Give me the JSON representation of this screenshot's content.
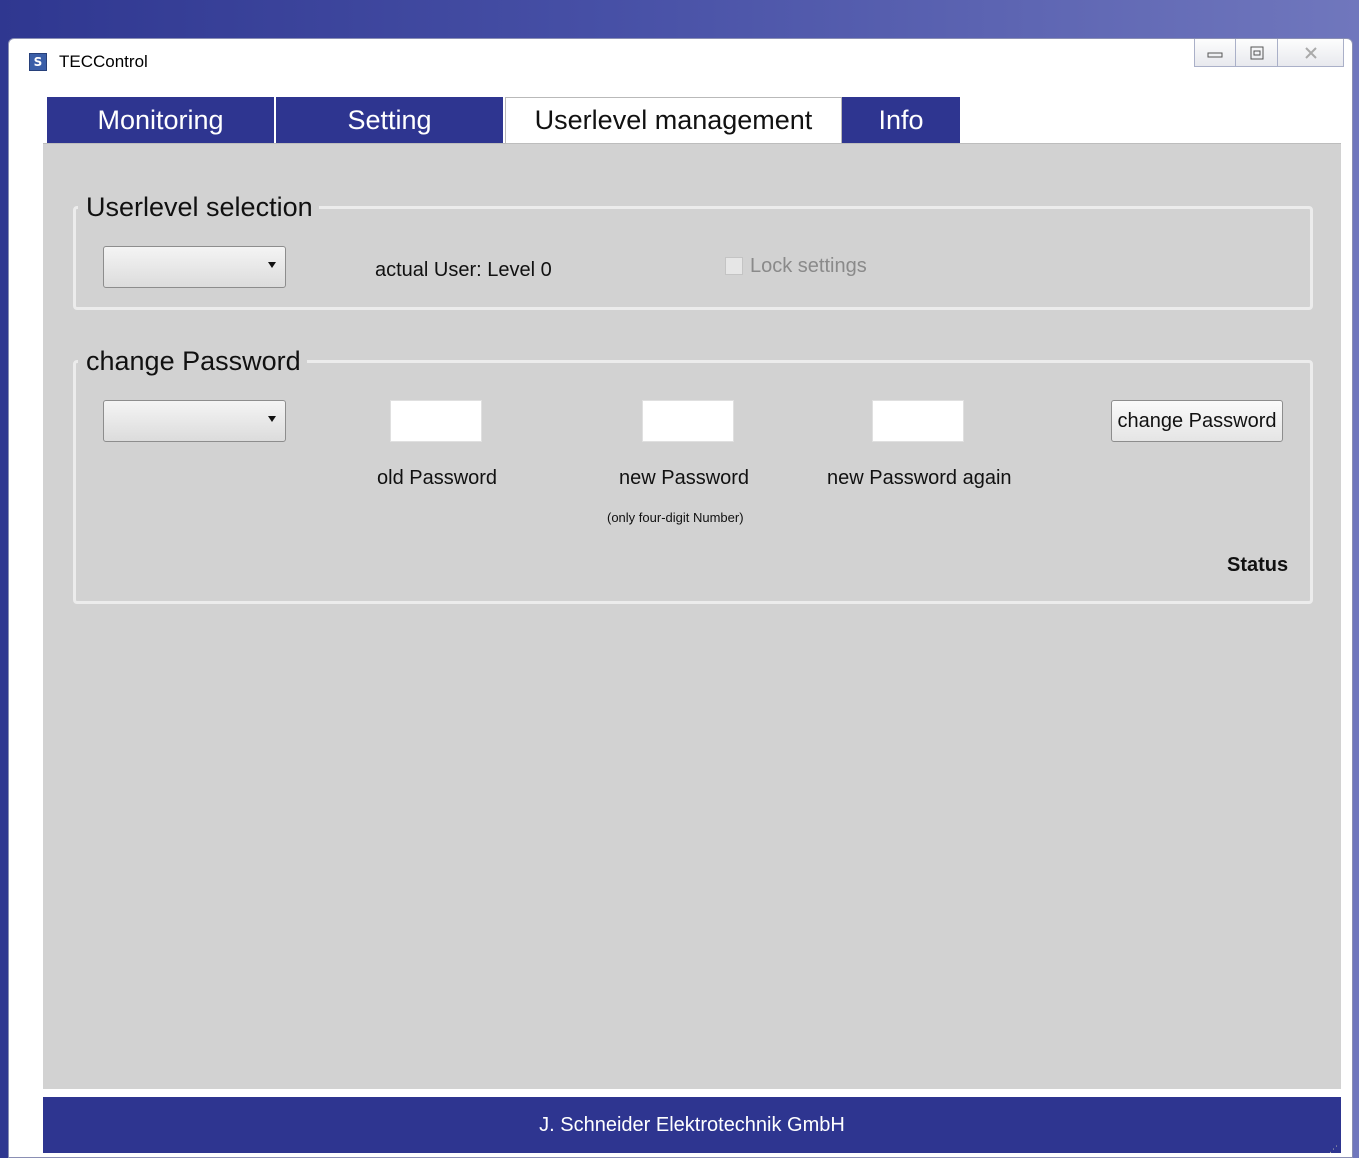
{
  "window": {
    "title": "TECControl",
    "controls": {
      "minimize_icon": "minimize-icon",
      "restore_icon": "restore-icon",
      "close_icon": "close-icon"
    }
  },
  "tabs": [
    {
      "label": "Monitoring",
      "active": false
    },
    {
      "label": "Setting",
      "active": false
    },
    {
      "label": "Userlevel management",
      "active": true
    },
    {
      "label": "Info",
      "active": false
    }
  ],
  "userlevel_selection": {
    "title": "Userlevel selection",
    "combo_value": "",
    "actual_user": "actual User: Level 0",
    "lock_label": "Lock settings",
    "lock_checked": false
  },
  "change_password": {
    "title": "change Password",
    "combo_value": "",
    "old_password_label": "old Password",
    "new_password_label": "new Password",
    "new_password_hint": "(only four-digit Number)",
    "new_password_again_label": "new Password again",
    "button_label": "change Password",
    "status_label": "Status"
  },
  "footer": {
    "company": "J. Schneider Elektrotechnik GmbH"
  },
  "colors": {
    "tab_bar": "#2e3590",
    "panel_bg": "#d2d2d2",
    "footer_bg": "#2e3590"
  }
}
